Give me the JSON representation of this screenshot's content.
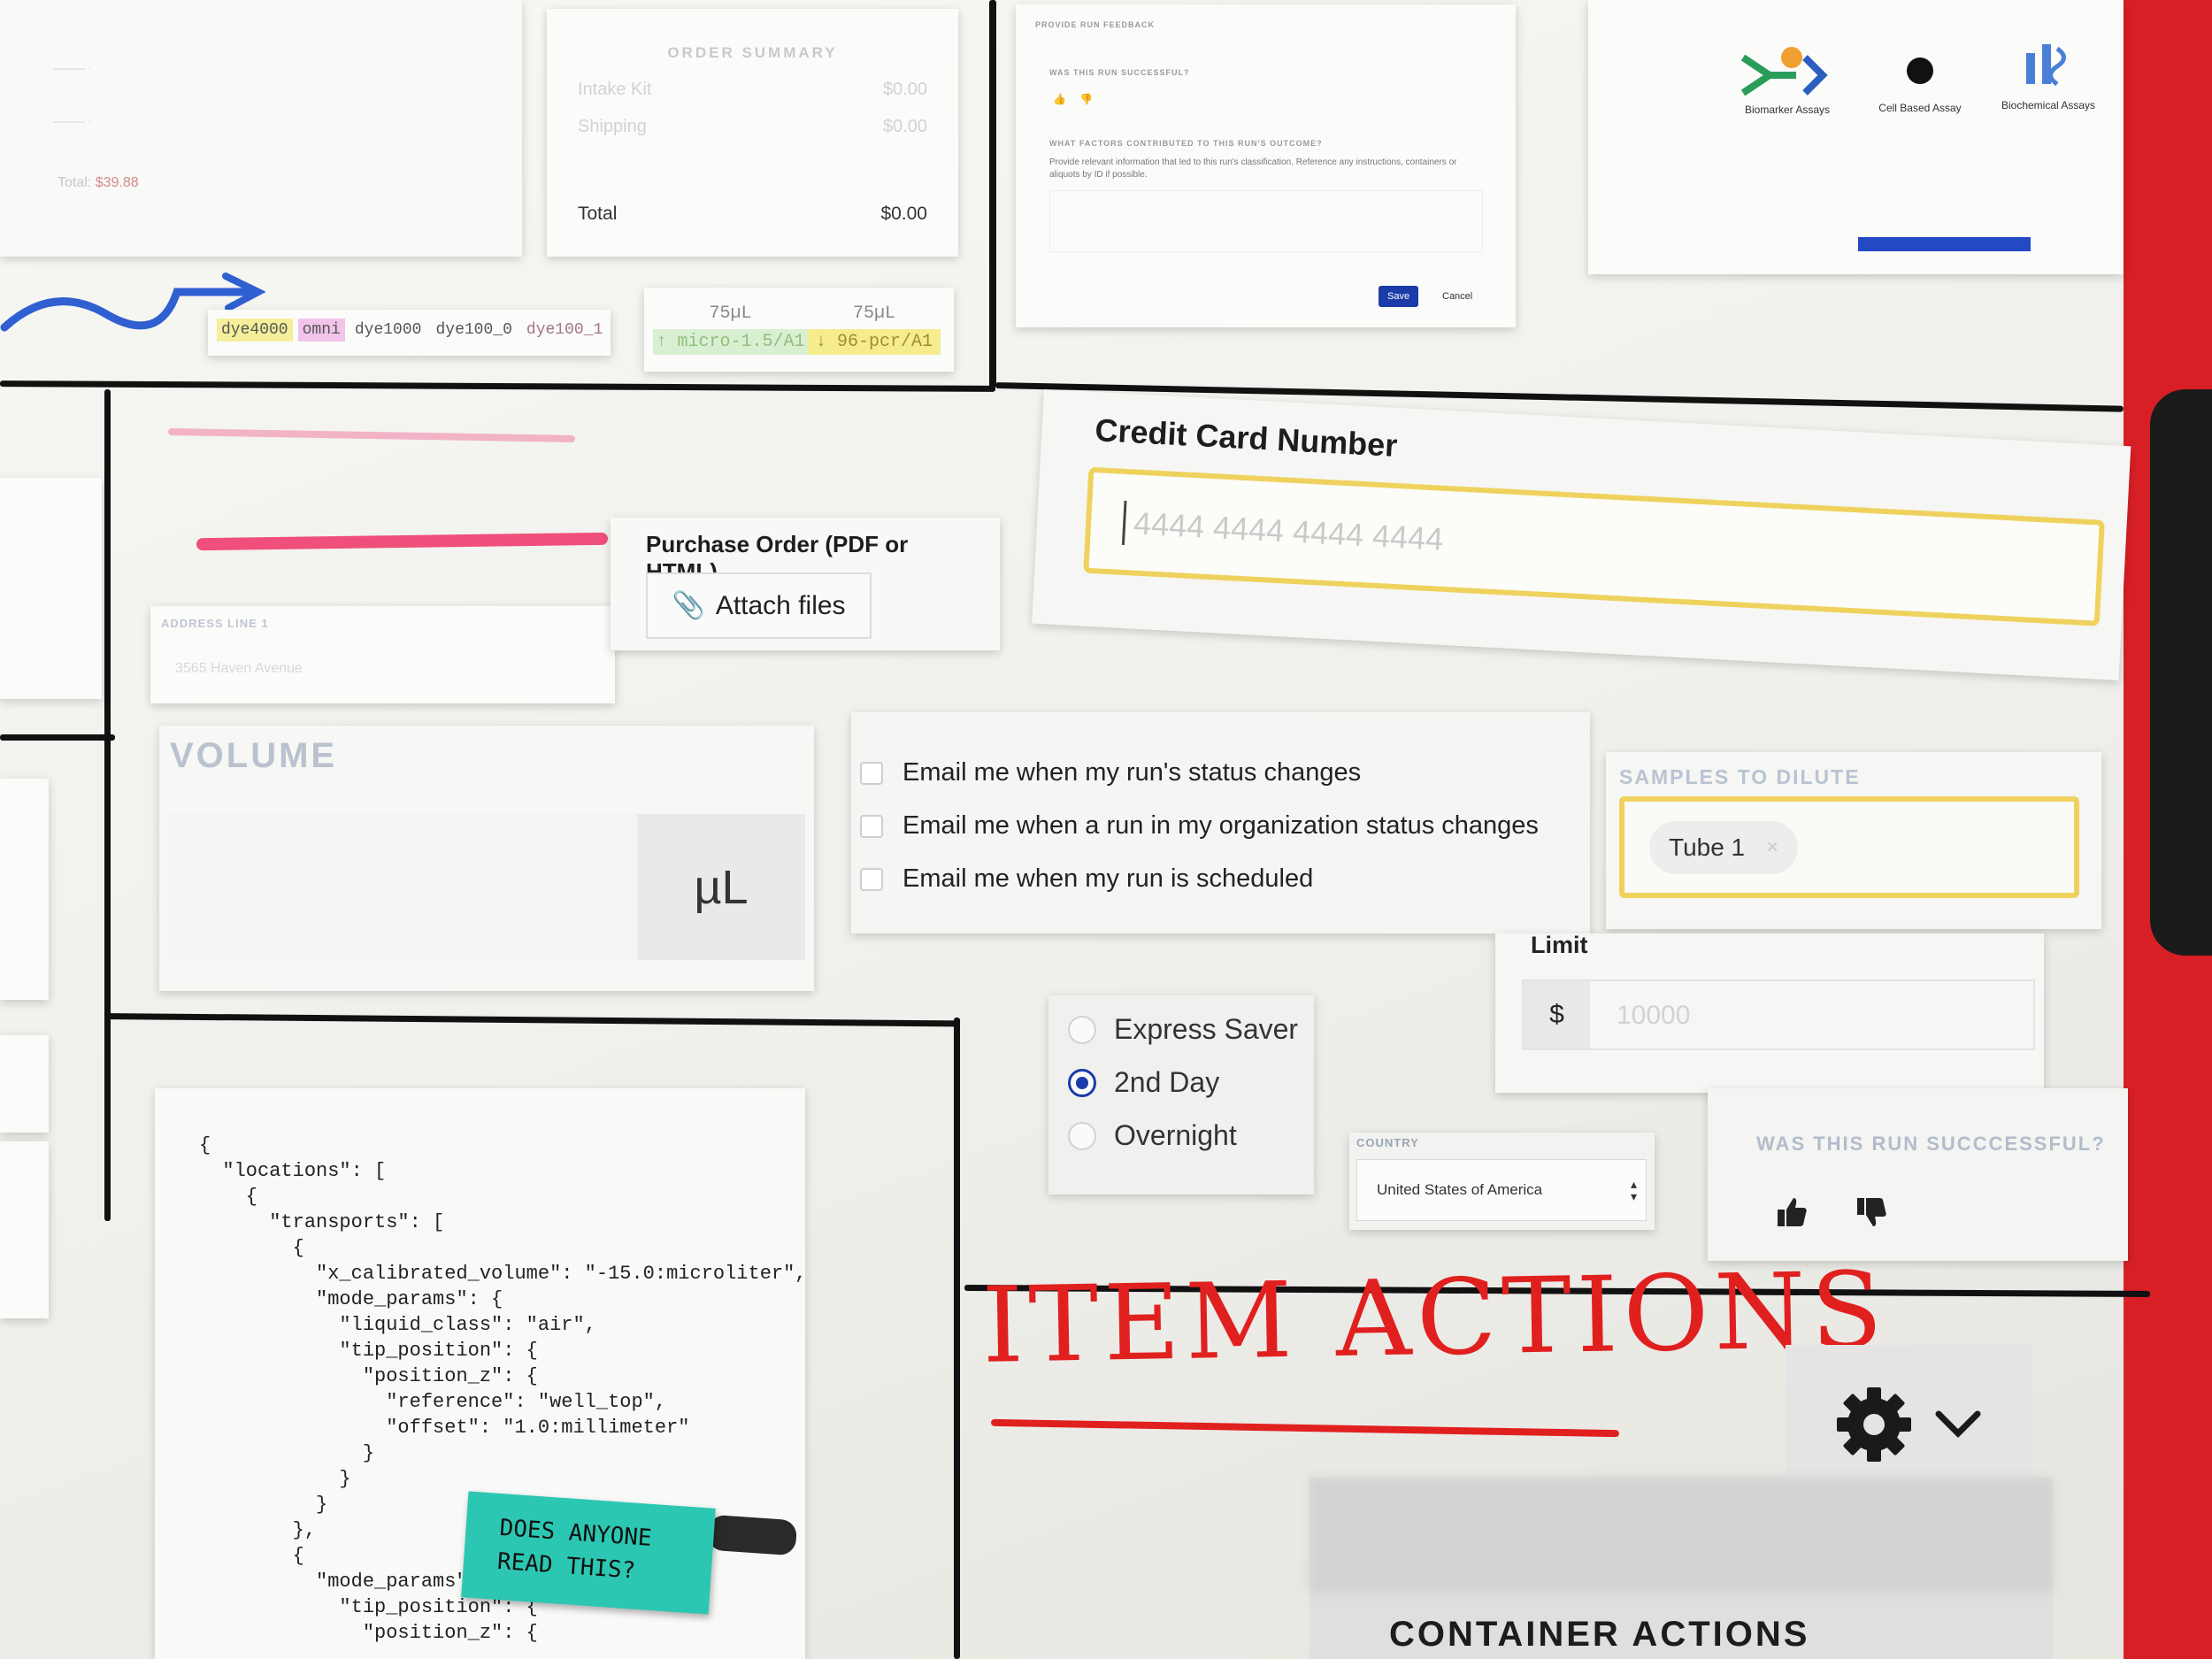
{
  "order_summary": {
    "title": "ORDER SUMMARY",
    "rows": [
      {
        "label": "Intake Kit",
        "value": "$0.00"
      },
      {
        "label": "Shipping",
        "value": "$0.00"
      }
    ],
    "total_label": "Total",
    "total_value": "$0.00"
  },
  "left_scrap": {
    "total_label": "Total:",
    "total_value": "$39.88"
  },
  "dye_tags": [
    "dye4000",
    "omni",
    "dye1000",
    "dye100_0",
    "dye100_1"
  ],
  "volume_tags": [
    {
      "volume": "75µL",
      "label": "micro-1.5/A1"
    },
    {
      "volume": "75µL",
      "label": "96-pcr/A1"
    }
  ],
  "feedback": {
    "heading": "PROVIDE RUN FEEDBACK",
    "question": "WAS THIS RUN SUCCESSFUL?",
    "factors_heading": "WHAT FACTORS CONTRIBUTED TO THIS RUN'S OUTCOME?",
    "help": "Provide relevant information that led to this run's classification. Reference any instructions, containers or aliquots by ID if possible.",
    "save": "Save",
    "cancel": "Cancel"
  },
  "assays": {
    "items": [
      "Biomarker Assays",
      "Cell Based Assay",
      "Biochemical Assays"
    ]
  },
  "credit_card": {
    "label": "Credit Card Number",
    "placeholder": "4444 4444 4444 4444"
  },
  "purchase_order": {
    "label": "Purchase Order (PDF or HTML)",
    "button": "Attach files"
  },
  "address": {
    "label": "ADDRESS LINE 1",
    "placeholder": "3565 Haven Avenue"
  },
  "volume": {
    "label": "VOLUME",
    "unit": "µL"
  },
  "notifications": [
    "Email me when my run's status changes",
    "Email me when a run in my organization status changes",
    "Email me when my run is scheduled"
  ],
  "samples": {
    "label": "SAMPLES TO DILUTE",
    "chip": "Tube 1",
    "chip_remove": "×"
  },
  "limit": {
    "label": "Limit",
    "prefix": "$",
    "placeholder": "10000"
  },
  "shipping_options": {
    "options": [
      "Express Saver",
      "2nd Day",
      "Overnight"
    ],
    "selected": "2nd Day"
  },
  "country": {
    "label": "COUNTRY",
    "value": "United States of America"
  },
  "run_success": {
    "label": "WAS THIS RUN SUCCCESSFUL?"
  },
  "code_sample": "{\n  \"locations\": [\n    {\n      \"transports\": [\n        {\n          \"x_calibrated_volume\": \"-15.0:microliter\",\n          \"mode_params\": {\n            \"liquid_class\": \"air\",\n            \"tip_position\": {\n              \"position_z\": {\n                \"reference\": \"well_top\",\n                \"offset\": \"1.0:millimeter\"\n              }\n            }\n          }\n        },\n        {\n          \"mode_params\": {\n            \"tip_position\": {\n              \"position_z\": {",
  "sticky_note": "DOES ANYONE\nREAD THIS?",
  "item_actions": {
    "title": "ITEM ACTIONS",
    "container_actions": "CONTAINER ACTIONS"
  },
  "colors": {
    "accent_yellow": "#efd25e",
    "brand_blue": "#1b3ca8",
    "marker_red": "#e0201f",
    "sticky_teal": "#2cc7b2"
  }
}
